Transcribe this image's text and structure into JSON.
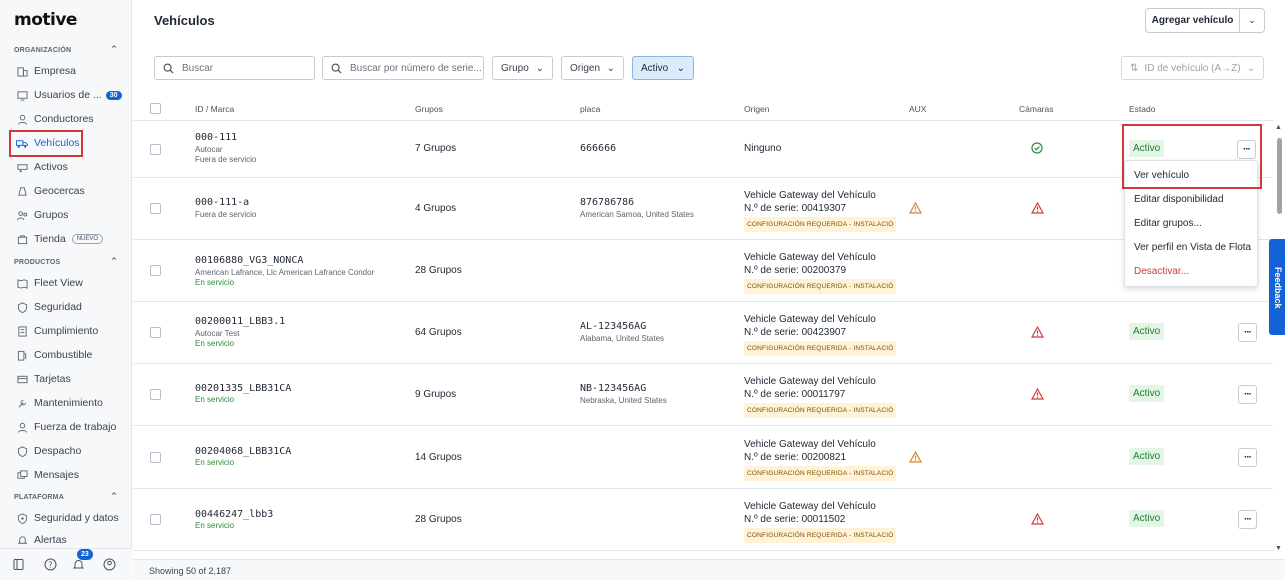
{
  "brand": "motive",
  "sidebar": {
    "org_header": "ORGANIZACIÓN",
    "org_items": [
      {
        "label": "Empresa",
        "icon": "building-icon"
      },
      {
        "label": "Usuarios de ...",
        "icon": "monitor-icon",
        "badge": "30"
      },
      {
        "label": "Conductores",
        "icon": "person-icon"
      },
      {
        "label": "Vehículos",
        "icon": "truck-icon",
        "active": true
      },
      {
        "label": "Activos",
        "icon": "trailer-icon"
      },
      {
        "label": "Geocercas",
        "icon": "geofence-icon"
      },
      {
        "label": "Grupos",
        "icon": "groups-icon"
      },
      {
        "label": "Tienda",
        "icon": "store-icon",
        "pill": "NUEVO"
      }
    ],
    "products_header": "PRODUCTOS",
    "product_items": [
      {
        "label": "Fleet View",
        "icon": "map-icon"
      },
      {
        "label": "Seguridad",
        "icon": "shield-icon"
      },
      {
        "label": "Cumplimiento",
        "icon": "compliance-icon"
      },
      {
        "label": "Combustible",
        "icon": "fuel-icon"
      },
      {
        "label": "Tarjetas",
        "icon": "card-icon"
      },
      {
        "label": "Mantenimiento",
        "icon": "wrench-icon"
      },
      {
        "label": "Fuerza de trabajo",
        "icon": "worker-icon"
      },
      {
        "label": "Despacho",
        "icon": "dispatch-icon"
      },
      {
        "label": "Mensajes",
        "icon": "message-icon"
      }
    ],
    "platform_header": "PLATAFORMA",
    "platform_items": [
      {
        "label": "Seguridad y datos",
        "icon": "lock-shield-icon"
      },
      {
        "label": "Alertas",
        "icon": "bell-icon"
      }
    ],
    "notifications_count": "23"
  },
  "page": {
    "title": "Vehículos",
    "add_button": "Agregar vehículo"
  },
  "filters": {
    "search_placeholder": "Buscar",
    "serial_placeholder": "Buscar por número de serie...",
    "groups": "Grupo",
    "origin": "Origen",
    "status": "Activo",
    "sort": "ID de vehículo (A→Z)"
  },
  "table": {
    "headers": {
      "id": "ID / Marca",
      "groups": "Grupos",
      "plate": "placa",
      "origin": "Origen",
      "aux": "AUX",
      "cameras": "Cámaras",
      "status": "Estado"
    },
    "rows": [
      {
        "id": "000-111",
        "make": "Autocar",
        "service": "Fuera de servicio",
        "service_ok": false,
        "groups": "7 Grupos",
        "plate": "666666",
        "location": "",
        "origin": "Ninguno",
        "serial": "",
        "chip": "",
        "aux_warn": false,
        "cam": "check",
        "status": "Activo"
      },
      {
        "id": "000-111-a",
        "make": "",
        "service": "Fuera de servicio",
        "service_ok": false,
        "groups": "4 Grupos",
        "plate": "876786786",
        "location": "American Samoa, United States",
        "origin": "Vehicle Gateway del Vehículo",
        "serial": "N.º de serie: 00419307",
        "chip": "CONFIGURACIÓN REQUERIDA - INSTALACIÓ",
        "aux_warn": true,
        "cam": "warn",
        "status": ""
      },
      {
        "id": "00106880_VG3_NONCA",
        "make": "American Lafrance, Llc American Lafrance Condor",
        "service": "En servicio",
        "service_ok": true,
        "groups": "28 Grupos",
        "plate": "",
        "location": "",
        "origin": "Vehicle Gateway del Vehículo",
        "serial": "N.º de serie: 00200379",
        "chip": "CONFIGURACIÓN REQUERIDA - INSTALACIÓ",
        "aux_warn": false,
        "cam": "",
        "status": ""
      },
      {
        "id": "00200011_LBB3.1",
        "make": "Autocar Test",
        "service": "En servicio",
        "service_ok": true,
        "groups": "64 Grupos",
        "plate": "AL-123456AG",
        "location": "Alabama, United States",
        "origin": "Vehicle Gateway del Vehículo",
        "serial": "N.º de serie: 00423907",
        "chip": "CONFIGURACIÓN REQUERIDA - INSTALACIÓ",
        "aux_warn": false,
        "cam": "warn",
        "status": "Activo"
      },
      {
        "id": "00201335_LBB31CA",
        "make": "",
        "service": "En servicio",
        "service_ok": true,
        "groups": "9 Grupos",
        "plate": "NB-123456AG",
        "location": "Nebraska, United States",
        "origin": "Vehicle Gateway del Vehículo",
        "serial": "N.º de serie: 00011797",
        "chip": "CONFIGURACIÓN REQUERIDA - INSTALACIÓ",
        "aux_warn": false,
        "cam": "warn",
        "status": "Activo"
      },
      {
        "id": "00204068_LBB31CA",
        "make": "",
        "service": "En servicio",
        "service_ok": true,
        "groups": "14 Grupos",
        "plate": "",
        "location": "",
        "origin": "Vehicle Gateway del Vehículo",
        "serial": "N.º de serie: 00200821",
        "chip": "CONFIGURACIÓN REQUERIDA - INSTALACIÓ",
        "aux_warn": true,
        "cam": "",
        "status": "Activo"
      },
      {
        "id": "00446247_lbb3",
        "make": "",
        "service": "En servicio",
        "service_ok": true,
        "groups": "28 Grupos",
        "plate": "",
        "location": "",
        "origin": "Vehicle Gateway del Vehículo",
        "serial": "N.º de serie: 00011502",
        "chip": "CONFIGURACIÓN REQUERIDA - INSTALACIÓ",
        "aux_warn": false,
        "cam": "warn",
        "status": "Activo"
      }
    ]
  },
  "menu": {
    "items": [
      "Ver vehículo",
      "Editar disponibilidad",
      "Editar grupos...",
      "Ver perfil en Vista de Flota",
      "Desactivar..."
    ]
  },
  "footer": "Showing 50 of 2,187",
  "feedback": "Feedback",
  "colors": {
    "accent": "#1463d6",
    "success": "#237a33",
    "warning": "#e0573a",
    "highlight": "#d03a3a"
  }
}
